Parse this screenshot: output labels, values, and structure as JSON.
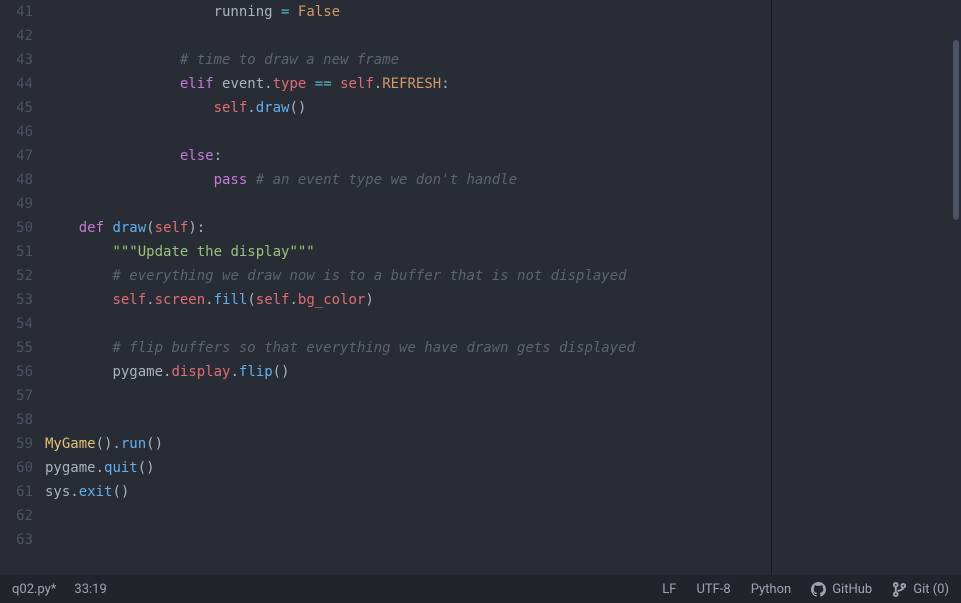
{
  "lines": [
    {
      "n": 41,
      "indent": 20,
      "tokens": [
        [
          "running",
          "tk-name"
        ],
        [
          " ",
          "tk-punc"
        ],
        [
          "=",
          "tk-op"
        ],
        [
          " ",
          "tk-punc"
        ],
        [
          "False",
          "tk-const"
        ]
      ]
    },
    {
      "n": 42,
      "indent": 0,
      "tokens": []
    },
    {
      "n": 43,
      "indent": 16,
      "tokens": [
        [
          "# time to draw a new frame",
          "tk-comment"
        ]
      ]
    },
    {
      "n": 44,
      "indent": 16,
      "tokens": [
        [
          "elif",
          "tk-kw"
        ],
        [
          " ",
          "tk-punc"
        ],
        [
          "event",
          "tk-name"
        ],
        [
          ".",
          "tk-punc"
        ],
        [
          "type",
          "tk-self"
        ],
        [
          " ",
          "tk-punc"
        ],
        [
          "==",
          "tk-op"
        ],
        [
          " ",
          "tk-punc"
        ],
        [
          "self",
          "tk-self"
        ],
        [
          ".",
          "tk-punc"
        ],
        [
          "REFRESH",
          "tk-const"
        ],
        [
          ":",
          "tk-punc"
        ]
      ]
    },
    {
      "n": 45,
      "indent": 20,
      "tokens": [
        [
          "self",
          "tk-self"
        ],
        [
          ".",
          "tk-punc"
        ],
        [
          "draw",
          "tk-fn"
        ],
        [
          "()",
          "tk-punc"
        ]
      ]
    },
    {
      "n": 46,
      "indent": 0,
      "tokens": []
    },
    {
      "n": 47,
      "indent": 16,
      "tokens": [
        [
          "else",
          "tk-kw"
        ],
        [
          ":",
          "tk-punc"
        ]
      ]
    },
    {
      "n": 48,
      "indent": 20,
      "tokens": [
        [
          "pass",
          "tk-kw"
        ],
        [
          " ",
          "tk-punc"
        ],
        [
          "# an event type we don't handle",
          "tk-comment"
        ]
      ]
    },
    {
      "n": 49,
      "indent": 0,
      "tokens": []
    },
    {
      "n": 50,
      "indent": 4,
      "tokens": [
        [
          "def",
          "tk-kw"
        ],
        [
          " ",
          "tk-punc"
        ],
        [
          "draw",
          "tk-fn"
        ],
        [
          "(",
          "tk-punc"
        ],
        [
          "self",
          "tk-self"
        ],
        [
          "):",
          "tk-punc"
        ]
      ]
    },
    {
      "n": 51,
      "indent": 8,
      "tokens": [
        [
          "\"\"\"Update the display\"\"\"",
          "tk-str"
        ]
      ]
    },
    {
      "n": 52,
      "indent": 8,
      "tokens": [
        [
          "# everything we draw now is to a buffer that is not displayed",
          "tk-comment"
        ]
      ]
    },
    {
      "n": 53,
      "indent": 8,
      "tokens": [
        [
          "self",
          "tk-self"
        ],
        [
          ".",
          "tk-punc"
        ],
        [
          "screen",
          "tk-self"
        ],
        [
          ".",
          "tk-punc"
        ],
        [
          "fill",
          "tk-fn"
        ],
        [
          "(",
          "tk-punc"
        ],
        [
          "self",
          "tk-self"
        ],
        [
          ".",
          "tk-punc"
        ],
        [
          "bg_color",
          "tk-self"
        ],
        [
          ")",
          "tk-punc"
        ]
      ]
    },
    {
      "n": 54,
      "indent": 0,
      "tokens": []
    },
    {
      "n": 55,
      "indent": 8,
      "tokens": [
        [
          "# flip buffers so that everything we have drawn gets displayed",
          "tk-comment"
        ]
      ]
    },
    {
      "n": 56,
      "indent": 8,
      "tokens": [
        [
          "pygame",
          "tk-name"
        ],
        [
          ".",
          "tk-punc"
        ],
        [
          "display",
          "tk-self"
        ],
        [
          ".",
          "tk-punc"
        ],
        [
          "flip",
          "tk-fn"
        ],
        [
          "()",
          "tk-punc"
        ]
      ]
    },
    {
      "n": 57,
      "indent": 0,
      "tokens": []
    },
    {
      "n": 58,
      "indent": 0,
      "tokens": []
    },
    {
      "n": 59,
      "indent": 0,
      "tokens": [
        [
          "MyGame",
          "tk-class"
        ],
        [
          "().",
          "tk-punc"
        ],
        [
          "run",
          "tk-fn"
        ],
        [
          "()",
          "tk-punc"
        ]
      ]
    },
    {
      "n": 60,
      "indent": 0,
      "tokens": [
        [
          "pygame",
          "tk-name"
        ],
        [
          ".",
          "tk-punc"
        ],
        [
          "quit",
          "tk-fn"
        ],
        [
          "()",
          "tk-punc"
        ]
      ]
    },
    {
      "n": 61,
      "indent": 0,
      "tokens": [
        [
          "sys",
          "tk-name"
        ],
        [
          ".",
          "tk-punc"
        ],
        [
          "exit",
          "tk-fn"
        ],
        [
          "()",
          "tk-punc"
        ]
      ]
    },
    {
      "n": 62,
      "indent": 0,
      "tokens": []
    },
    {
      "n": 63,
      "indent": 0,
      "tokens": []
    }
  ],
  "status": {
    "filename": "q02.py*",
    "cursor": "33:19",
    "line_ending": "LF",
    "encoding": "UTF-8",
    "language": "Python",
    "github": "GitHub",
    "git": "Git (0)"
  }
}
